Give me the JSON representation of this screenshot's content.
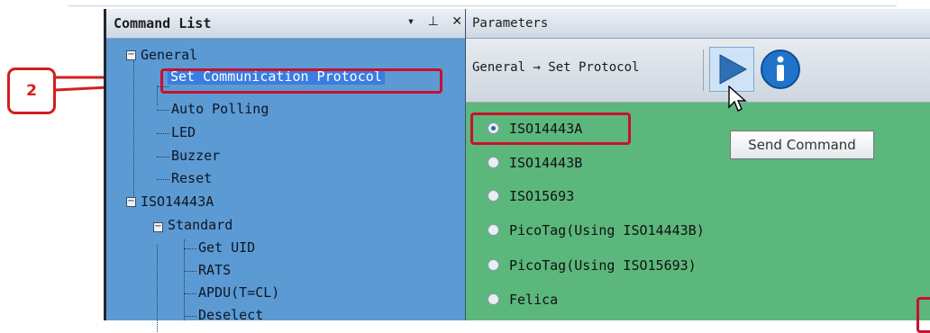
{
  "command_list": {
    "title": "Command List",
    "pin_icon": "pin-icon",
    "close_icon": "close-icon",
    "dropdown_icon": "dropdown-arrow-icon",
    "tree": {
      "general": {
        "label": "General",
        "children": [
          "Set Communication Protocol",
          "Auto Polling",
          "LED",
          "Buzzer",
          "Reset"
        ]
      },
      "iso14443a": {
        "label": "ISO14443A",
        "standard": {
          "label": "Standard",
          "children": [
            "Get UID",
            "RATS",
            "APDU(T=CL)",
            "Deselect"
          ]
        }
      }
    }
  },
  "parameters": {
    "title": "Parameters",
    "breadcrumb": "General → Set Protocol",
    "send_icon": "play-icon",
    "info_icon": "info-icon",
    "tooltip": "Send Command",
    "options": [
      "ISO14443A",
      "ISO14443B",
      "ISO15693",
      "PicoTag(Using ISO14443B)",
      "PicoTag(Using ISO15693)",
      "Felica"
    ],
    "selected": "ISO14443A"
  },
  "annotation": {
    "callout": "2",
    "color": "#d21f1f"
  }
}
